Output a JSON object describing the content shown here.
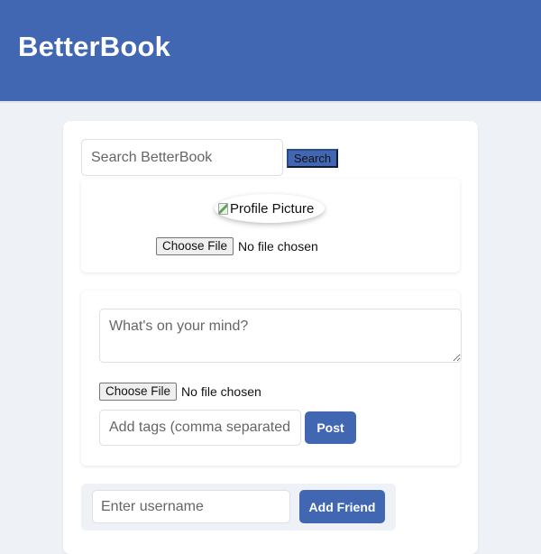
{
  "header": {
    "brand": "BetterBook",
    "brand_color": "#4267b2"
  },
  "search": {
    "placeholder": "Search BetterBook",
    "value": "",
    "button_label": "Search",
    "icon": "none"
  },
  "profile": {
    "picture_alt": "Profile Picture",
    "picture_icon": "broken-image-icon",
    "file_button_label": "Choose File",
    "file_status": "No file chosen"
  },
  "post": {
    "textarea_placeholder": "What's on your mind?",
    "textarea_value": "",
    "file_button_label": "Choose File",
    "file_status": "No file chosen",
    "tags_placeholder": "Add tags (comma separated",
    "tags_value": "",
    "submit_label": "Post"
  },
  "friends": {
    "username_placeholder": "Enter username",
    "username_value": "",
    "add_button_label": "Add Friend"
  },
  "colors": {
    "page_background": "#eef1f6",
    "card_background": "#ffffff",
    "primary": "#4267b2",
    "primary_text": "#ffffff"
  }
}
